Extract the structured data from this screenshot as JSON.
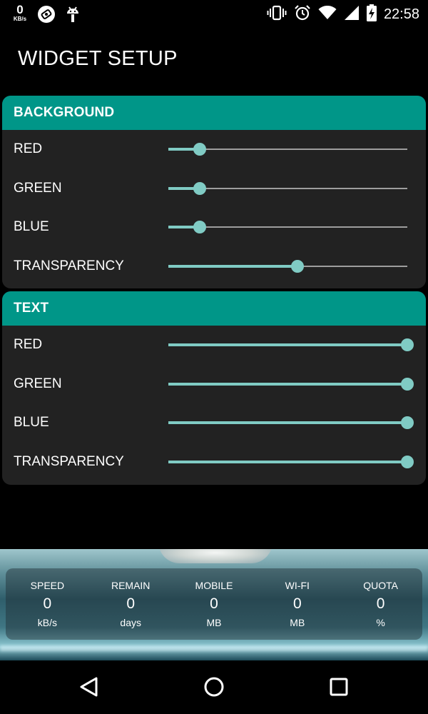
{
  "status_bar": {
    "speed_value": "0",
    "speed_unit": "KB/s",
    "time": "22:58",
    "icons": [
      "speed-indicator",
      "vpn-app-icon",
      "android-debug-icon",
      "vibrate-icon",
      "alarm-icon",
      "wifi-icon",
      "signal-icon",
      "battery-charging-icon"
    ]
  },
  "title": "WIDGET SETUP",
  "sections": [
    {
      "header": "BACKGROUND",
      "sliders": [
        {
          "label": "RED",
          "value": 0.13
        },
        {
          "label": "GREEN",
          "value": 0.13
        },
        {
          "label": "BLUE",
          "value": 0.13
        },
        {
          "label": "TRANSPARENCY",
          "value": 0.54
        }
      ]
    },
    {
      "header": "TEXT",
      "sliders": [
        {
          "label": "RED",
          "value": 1.0
        },
        {
          "label": "GREEN",
          "value": 1.0
        },
        {
          "label": "BLUE",
          "value": 1.0
        },
        {
          "label": "TRANSPARENCY",
          "value": 1.0
        }
      ]
    }
  ],
  "widget_preview": {
    "stats": [
      {
        "label": "SPEED",
        "value": "0",
        "unit": "kB/s"
      },
      {
        "label": "REMAIN",
        "value": "0",
        "unit": "days"
      },
      {
        "label": "MOBILE",
        "value": "0",
        "unit": "MB"
      },
      {
        "label": "WI-FI",
        "value": "0",
        "unit": "MB"
      },
      {
        "label": "QUOTA",
        "value": "0",
        "unit": "%"
      }
    ]
  },
  "colors": {
    "accent_header": "#009688",
    "slider_active": "#80cbc4",
    "slider_inactive": "#9e9e9e",
    "panel": "#222222",
    "background": "#000000"
  },
  "navigation": [
    "back-icon",
    "home-icon",
    "recents-icon"
  ]
}
